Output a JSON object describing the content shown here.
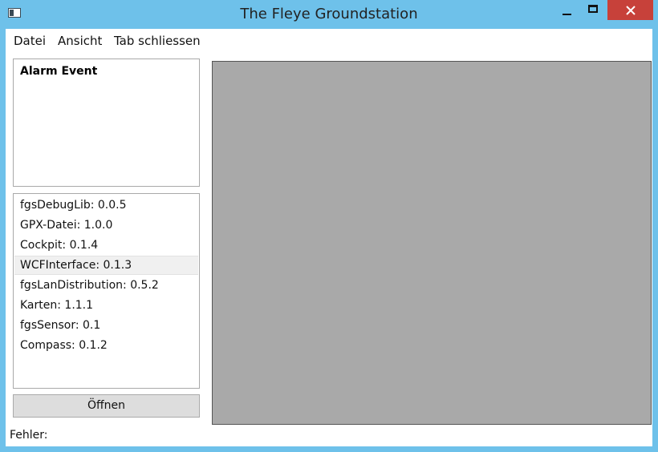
{
  "window": {
    "title": "The Fleye Groundstation",
    "close_color": "#c7413a",
    "titlebar_color": "#6ec1ea"
  },
  "menu": [
    "Datei",
    "Ansicht",
    "Tab schliessen"
  ],
  "alarm": {
    "title": "Alarm Event"
  },
  "modules": [
    "fgsDebugLib: 0.0.5",
    "GPX-Datei: 1.0.0",
    "Cockpit: 0.1.4",
    "WCFInterface: 0.1.3",
    "fgsLanDistribution: 0.5.2",
    "Karten: 1.1.1",
    "fgsSensor: 0.1",
    "Compass: 0.1.2"
  ],
  "open_button": "Öffnen",
  "status": {
    "label": "Fehler:"
  }
}
